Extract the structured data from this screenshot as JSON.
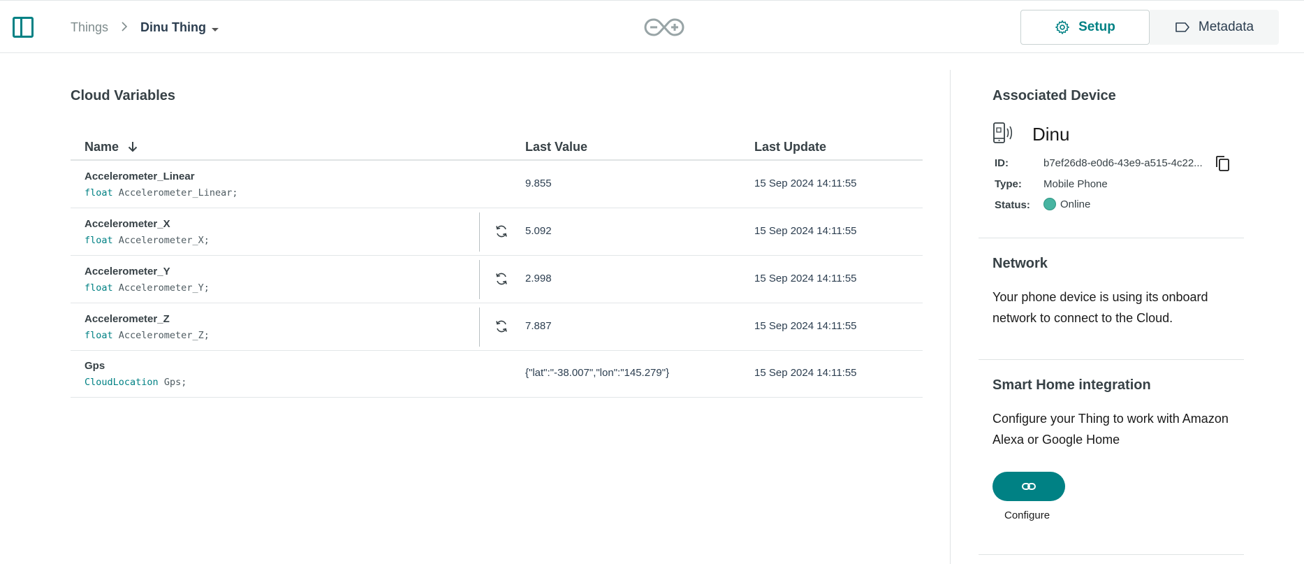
{
  "header": {
    "breadcrumb_root": "Things",
    "breadcrumb_separator": ">",
    "breadcrumb_current": "Dinu Thing",
    "tabs": [
      {
        "label": "Setup",
        "icon": "gear-icon",
        "active": true
      },
      {
        "label": "Metadata",
        "icon": "tag-icon",
        "active": false
      }
    ],
    "accent_color": "#008184"
  },
  "variables": {
    "title": "Cloud Variables",
    "columns": {
      "name": "Name",
      "last_value": "Last Value",
      "last_update": "Last Update"
    },
    "sort_icon": "arrow-down-icon",
    "rows": [
      {
        "name": "Accelerometer_Linear",
        "type": "float",
        "decl": "Accelerometer_Linear;",
        "value": "9.855",
        "update": "15 Sep 2024 14:11:55",
        "sync": false
      },
      {
        "name": "Accelerometer_X",
        "type": "float",
        "decl": "Accelerometer_X;",
        "value": "5.092",
        "update": "15 Sep 2024 14:11:55",
        "sync": true
      },
      {
        "name": "Accelerometer_Y",
        "type": "float",
        "decl": "Accelerometer_Y;",
        "value": "2.998",
        "update": "15 Sep 2024 14:11:55",
        "sync": true
      },
      {
        "name": "Accelerometer_Z",
        "type": "float",
        "decl": "Accelerometer_Z;",
        "value": "7.887",
        "update": "15 Sep 2024 14:11:55",
        "sync": true
      },
      {
        "name": "Gps",
        "type": "CloudLocation",
        "decl": "Gps;",
        "value": "{\"lat\":\"-38.007\",\"lon\":\"145.279\"}",
        "update": "15 Sep 2024 14:11:55",
        "sync": false
      }
    ]
  },
  "device": {
    "title": "Associated Device",
    "name": "Dinu",
    "id_label": "ID:",
    "id_value": "b7ef26d8-e0d6-43e9-a515-4c22...",
    "type_label": "Type:",
    "type_value": "Mobile Phone",
    "status_label": "Status:",
    "status_value": "Online",
    "status_color": "#47b4a1"
  },
  "network": {
    "title": "Network",
    "text": "Your phone device is using its onboard network to connect to the Cloud."
  },
  "smart_home": {
    "title": "Smart Home integration",
    "text": "Configure your Thing to work with Amazon Alexa or Google Home",
    "button_label": "Configure",
    "button_icon": "link-icon"
  }
}
